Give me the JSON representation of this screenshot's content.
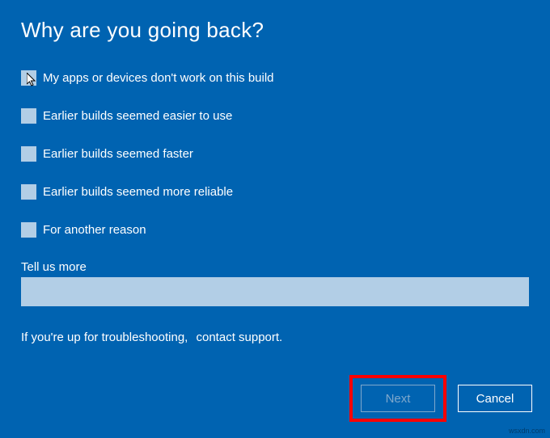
{
  "title": "Why are you going back?",
  "options": [
    "My apps or devices don't work on this build",
    "Earlier builds seemed easier to use",
    "Earlier builds seemed faster",
    "Earlier builds seemed more reliable",
    "For another reason"
  ],
  "tell_us_more_label": "Tell us more",
  "tell_us_more_value": "",
  "support_prefix": "If you're up for troubleshooting,",
  "support_link": "contact support.",
  "buttons": {
    "next": "Next",
    "cancel": "Cancel"
  },
  "watermark": "wsxdn.com"
}
